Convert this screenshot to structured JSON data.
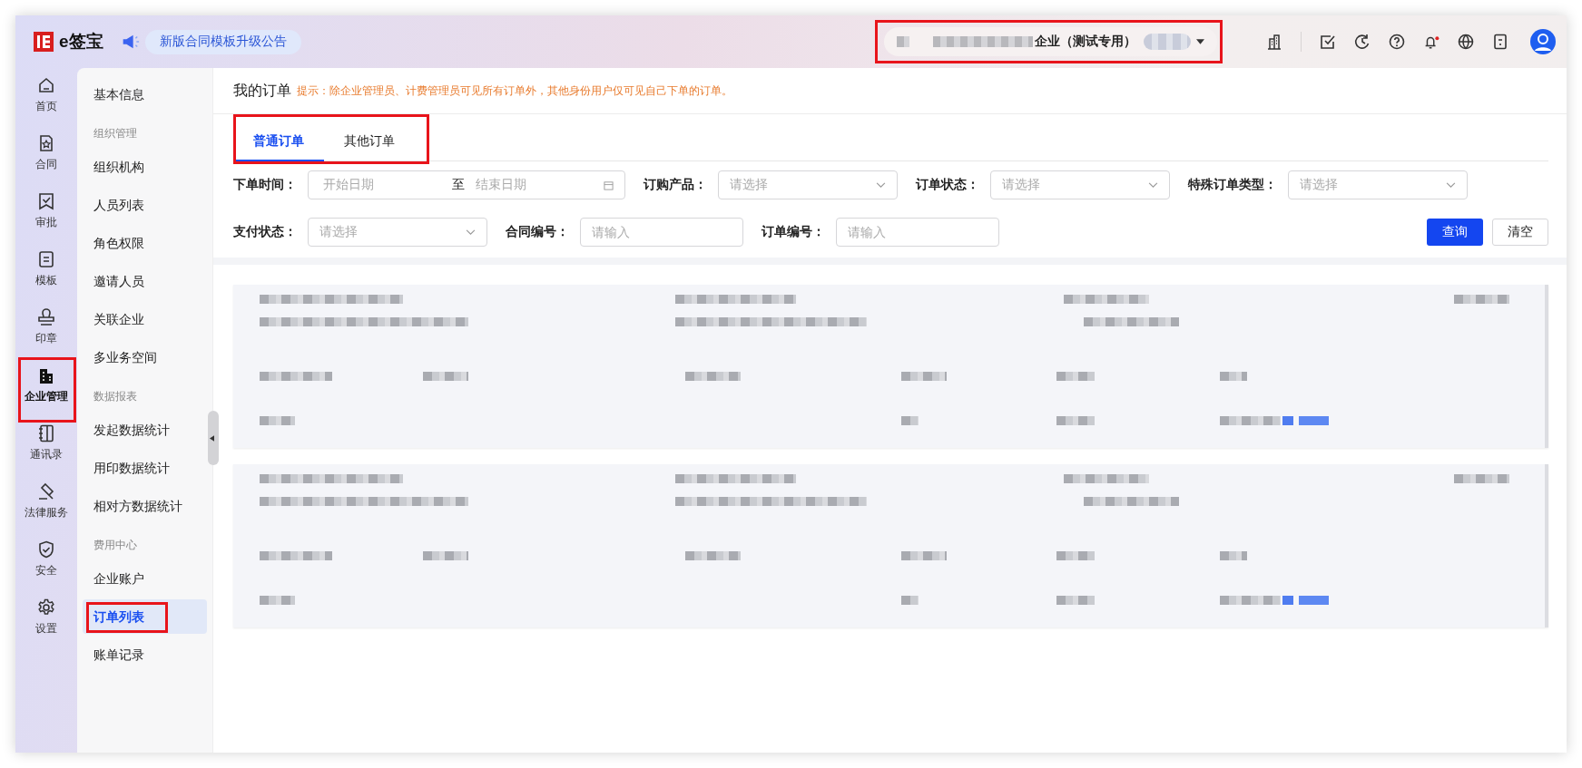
{
  "top_bar": {
    "logo": "e签宝",
    "announcement": "新版合同模板升级公告",
    "company": {
      "name": "企业（测试专用）",
      "highlighted": true
    },
    "unread_notifications": true
  },
  "rail": [
    {
      "label": "首页",
      "selected": false,
      "highlighted": false
    },
    {
      "label": "合同",
      "selected": false,
      "highlighted": false
    },
    {
      "label": "审批",
      "selected": false,
      "highlighted": false
    },
    {
      "label": "模板",
      "selected": false,
      "highlighted": false
    },
    {
      "label": "印章",
      "selected": false,
      "highlighted": false
    },
    {
      "label": "企业管理",
      "selected": true,
      "highlighted": true
    },
    {
      "label": "通讯录",
      "selected": false,
      "highlighted": false
    },
    {
      "label": "法律服务",
      "selected": false,
      "highlighted": false
    },
    {
      "label": "安全",
      "selected": false,
      "highlighted": false
    },
    {
      "label": "设置",
      "selected": false,
      "highlighted": false
    }
  ],
  "submenu": [
    {
      "kind": "item",
      "label": "基本信息",
      "selected": false,
      "highlighted": false
    },
    {
      "kind": "group",
      "label": "组织管理"
    },
    {
      "kind": "item",
      "label": "组织机构",
      "selected": false,
      "highlighted": false
    },
    {
      "kind": "item",
      "label": "人员列表",
      "selected": false,
      "highlighted": false
    },
    {
      "kind": "item",
      "label": "角色权限",
      "selected": false,
      "highlighted": false
    },
    {
      "kind": "item",
      "label": "邀请人员",
      "selected": false,
      "highlighted": false
    },
    {
      "kind": "item",
      "label": "关联企业",
      "selected": false,
      "highlighted": false
    },
    {
      "kind": "item",
      "label": "多业务空间",
      "selected": false,
      "highlighted": false
    },
    {
      "kind": "group",
      "label": "数据报表"
    },
    {
      "kind": "item",
      "label": "发起数据统计",
      "selected": false,
      "highlighted": false
    },
    {
      "kind": "item",
      "label": "用印数据统计",
      "selected": false,
      "highlighted": false
    },
    {
      "kind": "item",
      "label": "相对方数据统计",
      "selected": false,
      "highlighted": false
    },
    {
      "kind": "group",
      "label": "费用中心"
    },
    {
      "kind": "item",
      "label": "企业账户",
      "selected": false,
      "highlighted": false
    },
    {
      "kind": "item",
      "label": "订单列表",
      "selected": true,
      "highlighted": true
    },
    {
      "kind": "item",
      "label": "账单记录",
      "selected": false,
      "highlighted": false
    }
  ],
  "page": {
    "title": "我的订单",
    "hint": "提示：除企业管理员、计费管理员可见所有订单外，其他身份用户仅可见自己下单的订单。"
  },
  "tabs": {
    "highlighted": true,
    "items": [
      {
        "label": "普通订单",
        "selected": true
      },
      {
        "label": "其他订单",
        "selected": false
      }
    ]
  },
  "filters": [
    [
      {
        "kind": "date",
        "label": "下单时间：",
        "start_placeholder": "开始日期",
        "separator": "至",
        "end_placeholder": "结束日期"
      },
      {
        "kind": "select",
        "label": "订购产品：",
        "placeholder": "请选择"
      },
      {
        "kind": "select",
        "label": "订单状态：",
        "placeholder": "请选择"
      },
      {
        "kind": "select",
        "label": "特殊订单类型：",
        "placeholder": "请选择"
      }
    ],
    [
      {
        "kind": "select",
        "label": "支付状态：",
        "placeholder": "请选择"
      },
      {
        "kind": "input",
        "label": "合同编号：",
        "placeholder": "请输入"
      },
      {
        "kind": "input",
        "label": "订单编号：",
        "placeholder": "请输入"
      }
    ]
  ],
  "buttons": [
    {
      "kind": "primary",
      "label": "查询"
    },
    {
      "kind": "default",
      "label": "清空"
    }
  ],
  "orders": [
    {
      "kind": "redacted"
    },
    {
      "kind": "redacted"
    }
  ]
}
